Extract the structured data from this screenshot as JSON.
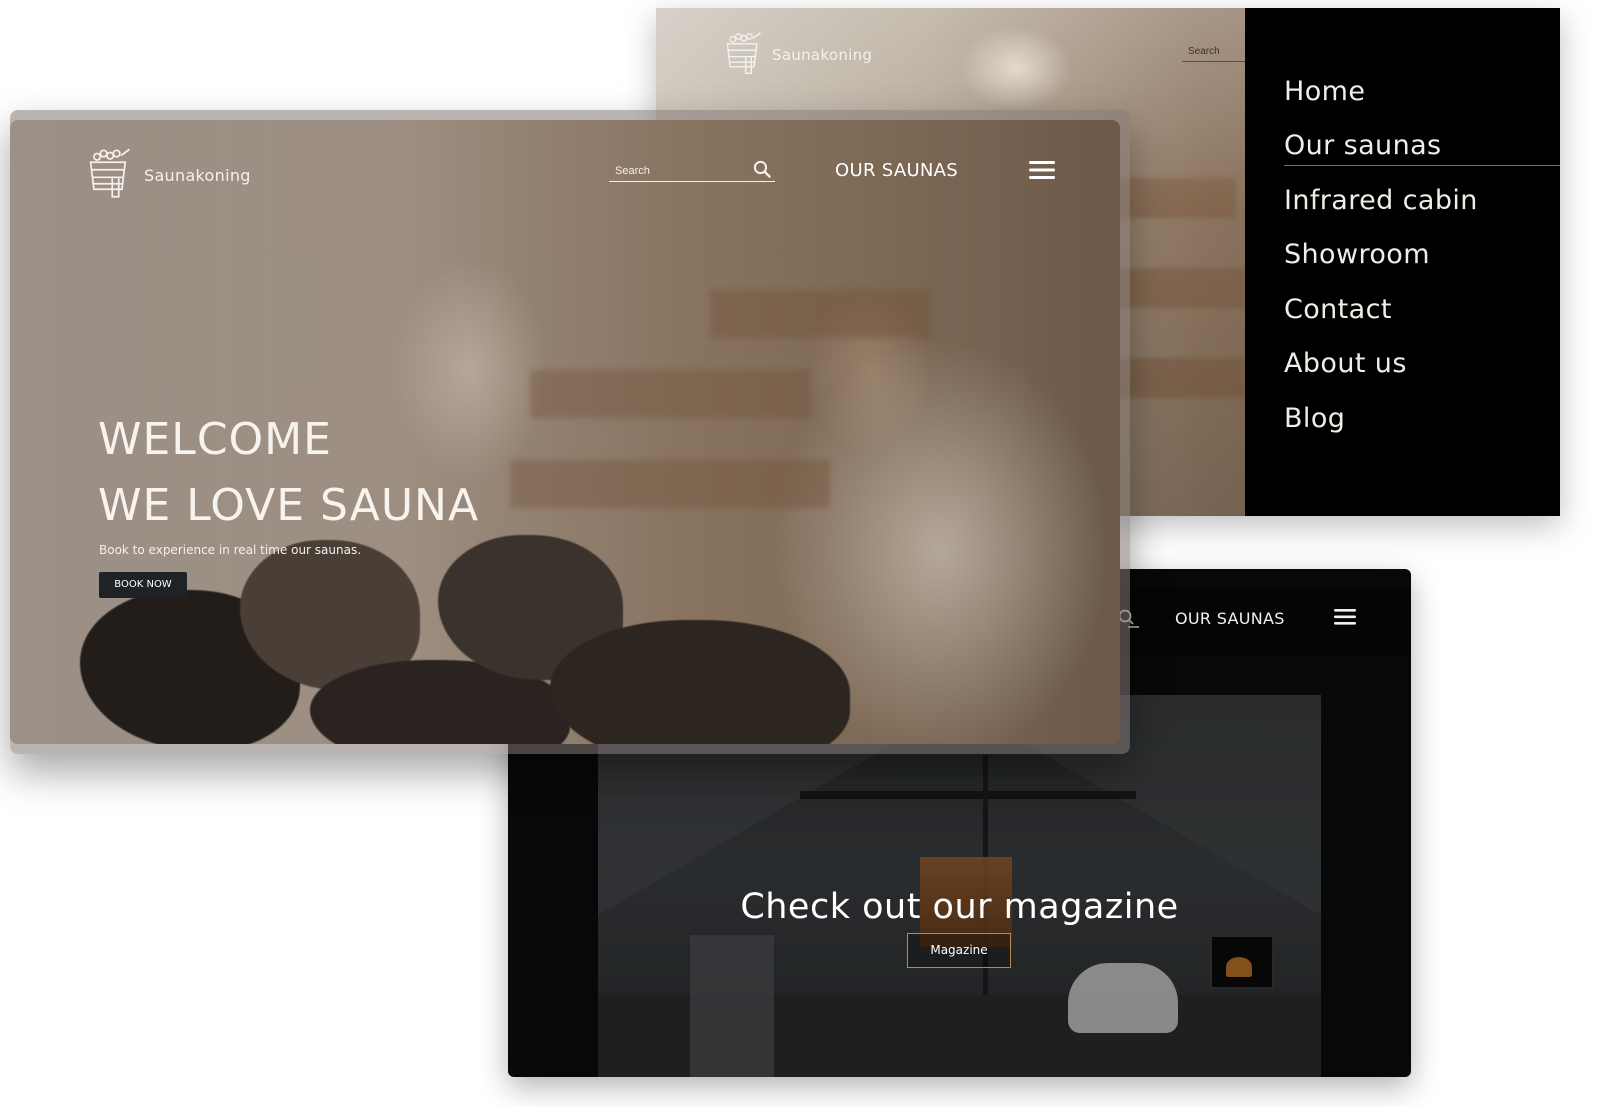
{
  "brand": {
    "name": "Saunakoning",
    "logo_icon": "sauna-bucket-icon"
  },
  "back_frame": {
    "search_placeholder": "Search",
    "menu": {
      "items": [
        {
          "label": "Home"
        },
        {
          "label": "Our saunas",
          "active": true
        },
        {
          "label": "Infrared cabin"
        },
        {
          "label": "Showroom"
        },
        {
          "label": "Contact"
        },
        {
          "label": "About us"
        },
        {
          "label": "Blog"
        }
      ],
      "active_color": "#b9573c"
    }
  },
  "front_frame": {
    "search_placeholder": "Search",
    "search_icon": "search-icon",
    "nav_label": "OUR SAUNAS",
    "menu_icon": "hamburger-icon",
    "hero": {
      "line1": "WELCOME",
      "line2": "WE LOVE SAUNA",
      "subtitle": "Book to experience in real time our saunas.",
      "button_label": "BOOK NOW"
    }
  },
  "bottom_frame": {
    "nav_label": "OUR SAUNAS",
    "search_icon": "search-icon",
    "menu_icon": "hamburger-icon",
    "title": "Check out our magazine",
    "button_label": "Magazine",
    "button_border_color": "#b58a4f"
  }
}
